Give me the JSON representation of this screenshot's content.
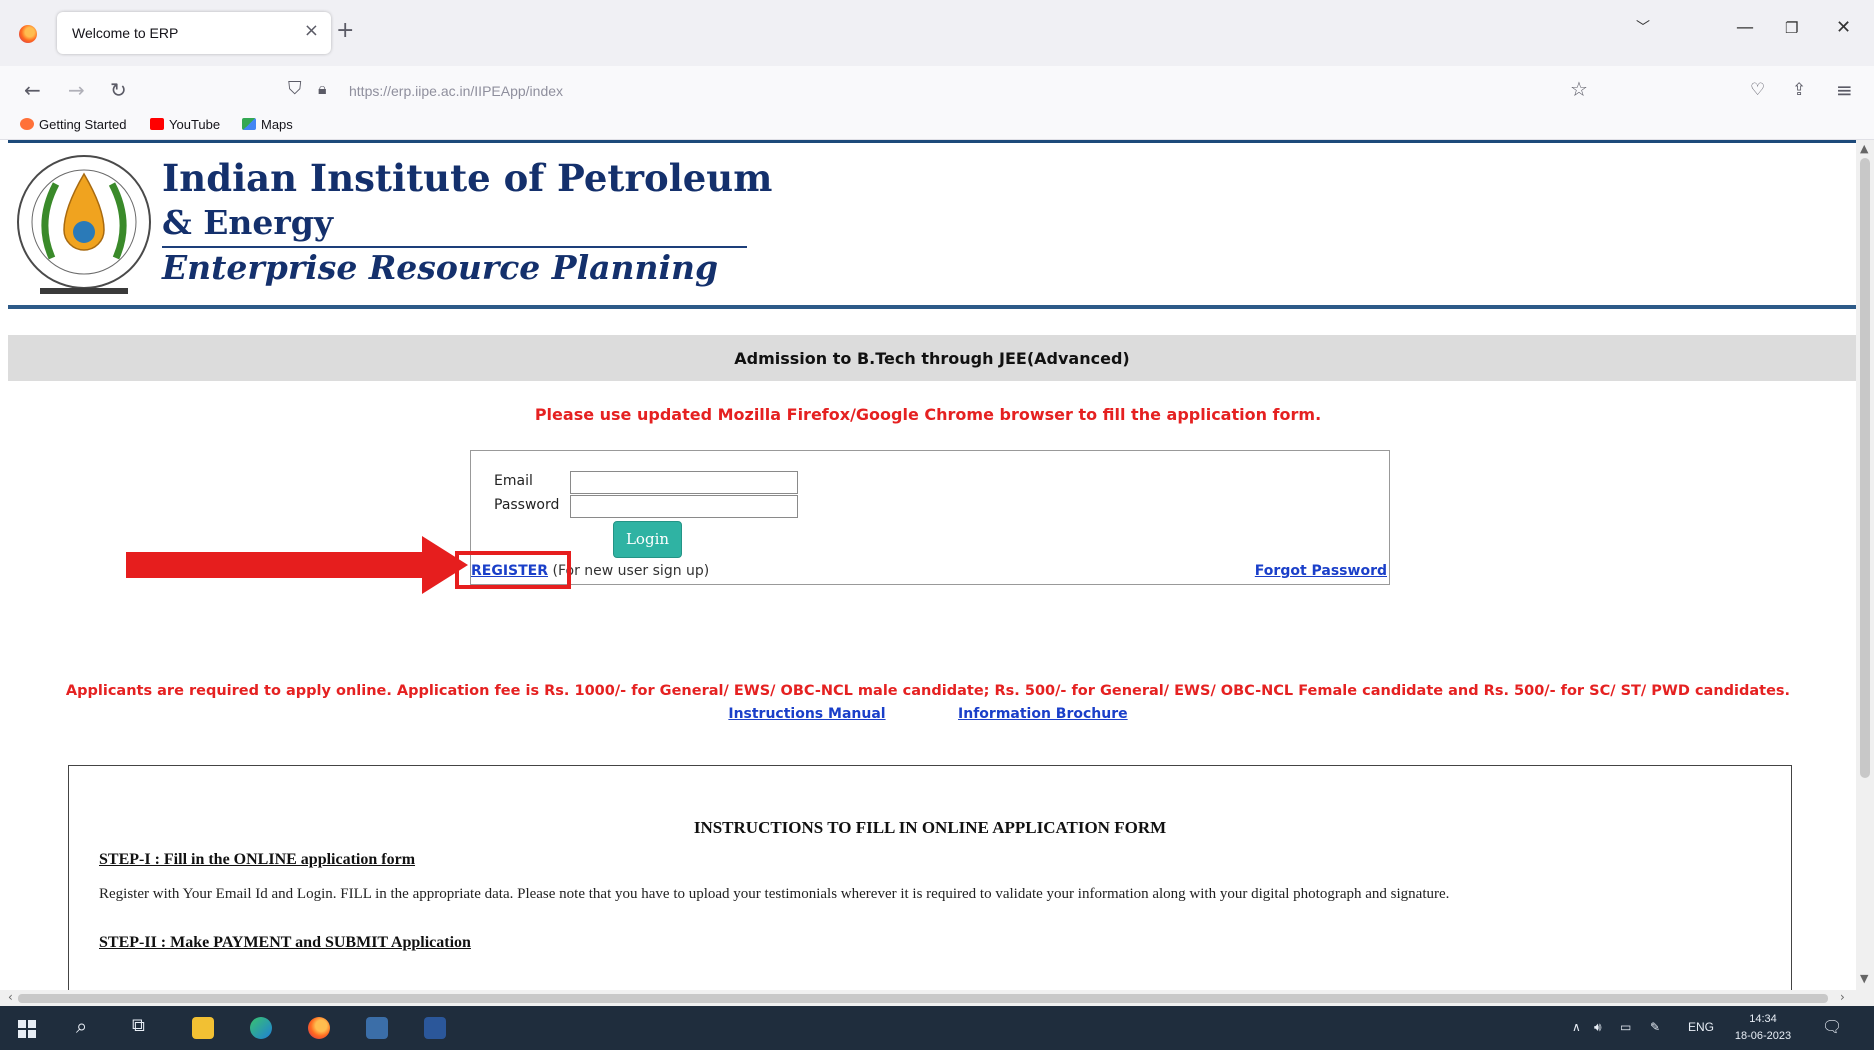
{
  "browser": {
    "tab_title": "Welcome to ERP",
    "tab_close": "×",
    "new_tab": "+",
    "url": "https://erp.iipe.ac.in/IIPEApp/index",
    "bookmarks": [
      {
        "label": "Getting Started",
        "color": "#ff7139"
      },
      {
        "label": "YouTube",
        "color": "#ff0000"
      },
      {
        "label": "Maps",
        "color": "#34a853"
      }
    ]
  },
  "header": {
    "institute_line1": "Indian Institute of Petroleum",
    "institute_line2": "& Energy",
    "system_name": "Enterprise Resource Planning"
  },
  "admission_title": "Admission to B.Tech through JEE(Advanced)",
  "browser_note": "Please use updated Mozilla Firefox/Google Chrome browser to fill the application form.",
  "login": {
    "email_label": "Email",
    "password_label": "Password",
    "email_value": "",
    "password_value": "",
    "login_button": "Login",
    "register_link": "REGISTER",
    "register_suffix": " (For new user sign up)",
    "forgot_link": "Forgot Password"
  },
  "fee_note": "Applicants are required to apply online. Application fee is Rs. 1000/- for General/ EWS/ OBC-NCL male candidate; Rs. 500/- for General/ EWS/ OBC-NCL Female candidate and Rs. 500/- for SC/ ST/ PWD candidates.",
  "doc_links": {
    "instructions_manual": "Instructions Manual",
    "information_brochure": "Information Brochure"
  },
  "instructions": {
    "title": "INSTRUCTIONS TO FILL IN ONLINE APPLICATION FORM",
    "step1_title": "STEP-I : Fill in the ONLINE application form",
    "step1_body": "Register with Your Email Id and Login. FILL in the appropriate data. Please note that you have to upload your testimonials wherever it is required to validate your information along with your digital photograph and signature.",
    "step2_title": "STEP-II : Make PAYMENT and SUBMIT Application"
  },
  "taskbar": {
    "language": "ENG",
    "time": "14:34",
    "date": "18-06-2023"
  },
  "colors": {
    "brand_navy": "#14306c",
    "alert_red": "#e52121",
    "link_blue": "#1a3fc9",
    "login_teal": "#2fb3a3"
  }
}
